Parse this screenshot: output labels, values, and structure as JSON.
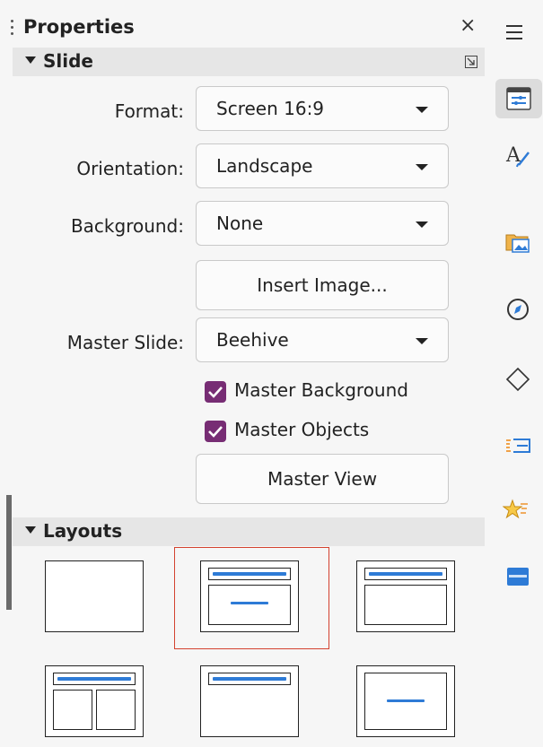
{
  "panel": {
    "title": "Properties",
    "close_glyph": "×"
  },
  "slide_section": {
    "title": "Slide",
    "format": {
      "label": "Format:",
      "value": "Screen 16:9"
    },
    "orientation": {
      "label": "Orientation:",
      "value": "Landscape"
    },
    "background": {
      "label": "Background:",
      "value": "None"
    },
    "insert_image_label": "Insert Image...",
    "master_slide": {
      "label": "Master Slide:",
      "value": "Beehive"
    },
    "master_background": {
      "label": "Master Background",
      "checked": true
    },
    "master_objects": {
      "label": "Master Objects",
      "checked": true
    },
    "master_view_label": "Master View"
  },
  "layouts_section": {
    "title": "Layouts",
    "items": [
      {
        "name": "blank-slide",
        "selected": false
      },
      {
        "name": "title-content",
        "selected": true
      },
      {
        "name": "title-content-2",
        "selected": false
      },
      {
        "name": "title-two-content",
        "selected": false
      },
      {
        "name": "title-only",
        "selected": false
      },
      {
        "name": "centered-text",
        "selected": false
      }
    ]
  },
  "tabbar": {
    "icons": [
      "menu-icon",
      "properties-icon",
      "styles-icon",
      "gallery-icon",
      "navigator-icon",
      "shapes-icon",
      "slide-transition-icon",
      "animation-icon",
      "master-slides-icon"
    ]
  },
  "colors": {
    "accent": "#2e7bd6",
    "checkbox": "#772d74",
    "selection": "#d3422f"
  }
}
